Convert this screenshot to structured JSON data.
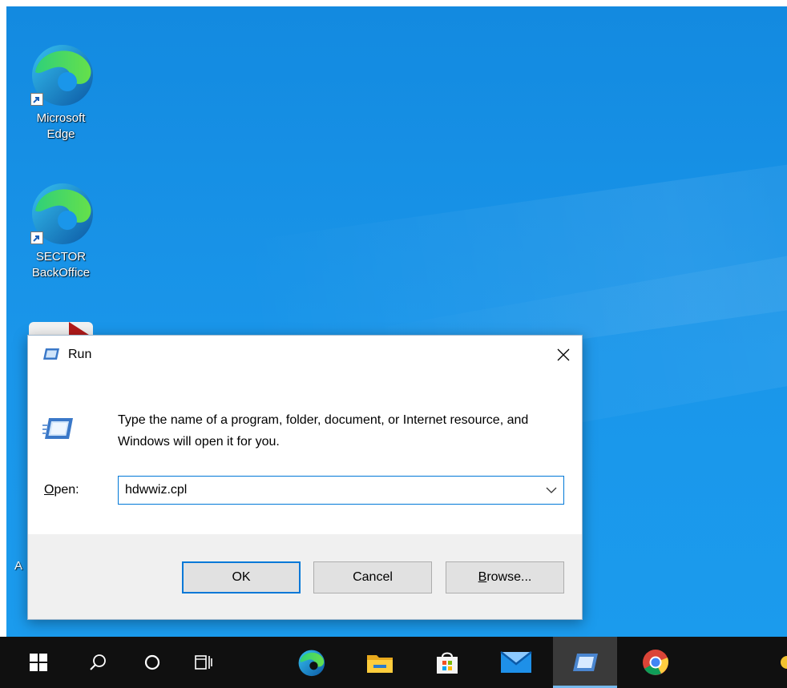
{
  "desktop": {
    "icons": [
      {
        "label": "Microsoft\nEdge",
        "icon": "edge-icon"
      },
      {
        "label": "SECTOR\nBackOffice",
        "icon": "edge-icon"
      }
    ],
    "partial_label": "A"
  },
  "run_dialog": {
    "title": "Run",
    "description": "Type the name of a program, folder, document, or Internet resource, and Windows will open it for you.",
    "open_label_accel": "O",
    "open_label_rest": "pen:",
    "open_value": "hdwwiz.cpl",
    "ok_label": "OK",
    "cancel_label": "Cancel",
    "browse_label_accel": "B",
    "browse_label_rest": "rowse..."
  },
  "taskbar": {
    "items": [
      "windows-start-icon",
      "search-icon",
      "cortana-icon",
      "task-view-icon",
      "edge-icon",
      "file-explorer-icon",
      "store-icon",
      "mail-icon",
      "run-icon",
      "chrome-icon"
    ],
    "active_item": "run-icon"
  },
  "colors": {
    "desktop": "#1a96ea",
    "accent": "#0078d7",
    "taskbar": "#101010"
  }
}
